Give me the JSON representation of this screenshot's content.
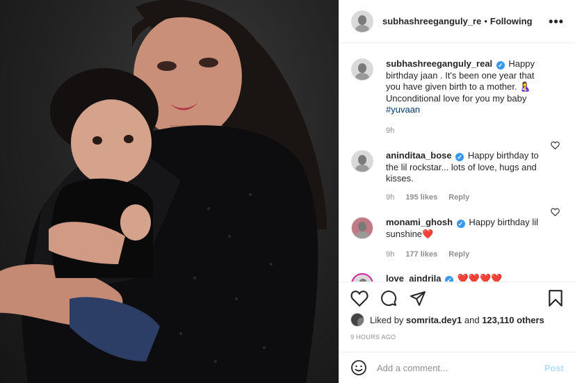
{
  "header": {
    "username": "subhashreeganguly_re",
    "separator": "•",
    "follow_status": "Following",
    "more_icon": "•••"
  },
  "caption": {
    "username": "subhashreeganguly_real",
    "text": "Happy birthday jaan . It's been one year that you have given birth to a mother. 🤱 Unconditional love for you my baby",
    "hashtag": "#yuvaan",
    "time": "9h"
  },
  "comments": [
    {
      "username": "aninditaa_bose",
      "text": "Happy birthday to the lil rockstar... lots of love, hugs and kisses.",
      "time": "9h",
      "likes": "195 likes",
      "reply": "Reply"
    },
    {
      "username": "monami_ghosh",
      "text": "Happy birthday lil sunshine",
      "emoji": "❤️",
      "time": "9h",
      "likes": "177 likes",
      "reply": "Reply"
    },
    {
      "username": "love_aindrila",
      "text": "❤️❤️❤️❤️"
    }
  ],
  "likes_line": {
    "prefix": "Liked by",
    "user": "somrita.dey1",
    "middle": "and",
    "others": "123,110 others"
  },
  "time_ago": "9 HOURS AGO",
  "add_comment": {
    "placeholder": "Add a comment...",
    "post_label": "Post"
  },
  "colors": {
    "verified": "#3897f0",
    "hashtag": "#00376b",
    "post_button": "#b2dffc",
    "muted": "#8e8e8e"
  }
}
